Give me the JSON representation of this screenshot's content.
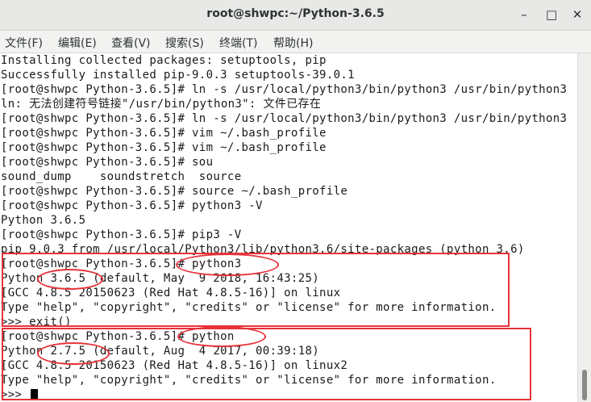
{
  "window": {
    "title": "root@shwpc:~/Python-3.6.5",
    "minimize_label": "–",
    "maximize_label": "□",
    "close_label": "✕"
  },
  "menu": [
    "文件(F)",
    "编辑(E)",
    "查看(V)",
    "搜索(S)",
    "终端(T)",
    "帮助(H)"
  ],
  "terminal_lines": [
    "Installing collected packages: setuptools, pip",
    "Successfully installed pip-9.0.3 setuptools-39.0.1",
    "[root@shwpc Python-3.6.5]# ln -s /usr/local/python3/bin/python3 /usr/bin/python3",
    "ln: 无法创建符号链接\"/usr/bin/python3\": 文件已存在",
    "[root@shwpc Python-3.6.5]# ln -s /usr/local/python3/bin/python3 /usr/bin/python3",
    "[root@shwpc Python-3.6.5]# vim ~/.bash_profile",
    "[root@shwpc Python-3.6.5]# vim ~/.bash_profile",
    "[root@shwpc Python-3.6.5]# sou",
    "sound_dump    soundstretch  source",
    "[root@shwpc Python-3.6.5]# source ~/.bash_profile",
    "[root@shwpc Python-3.6.5]# python3 -V",
    "Python 3.6.5",
    "[root@shwpc Python-3.6.5]# pip3 -V",
    "pip 9.0.3 from /usr/local/Python3/lib/python3.6/site-packages (python 3.6)",
    "[root@shwpc Python-3.6.5]# python3",
    "Python 3.6.5 (default, May  9 2018, 16:43:25)",
    "[GCC 4.8.5 20150623 (Red Hat 4.8.5-16)] on linux",
    "Type \"help\", \"copyright\", \"credits\" or \"license\" for more information.",
    ">>> exit()",
    "[root@shwpc Python-3.6.5]# python",
    "Python 2.7.5 (default, Aug  4 2017, 00:39:18)",
    "[GCC 4.8.5 20150623 (Red Hat 4.8.5-16)] on linux2",
    "Type \"help\", \"copyright\", \"credits\" or \"license\" for more information.",
    ">>> "
  ],
  "colors": {
    "annotation": "#e8323a",
    "terminal_text": "#1a1a1a",
    "terminal_bg": "#ffffff"
  }
}
